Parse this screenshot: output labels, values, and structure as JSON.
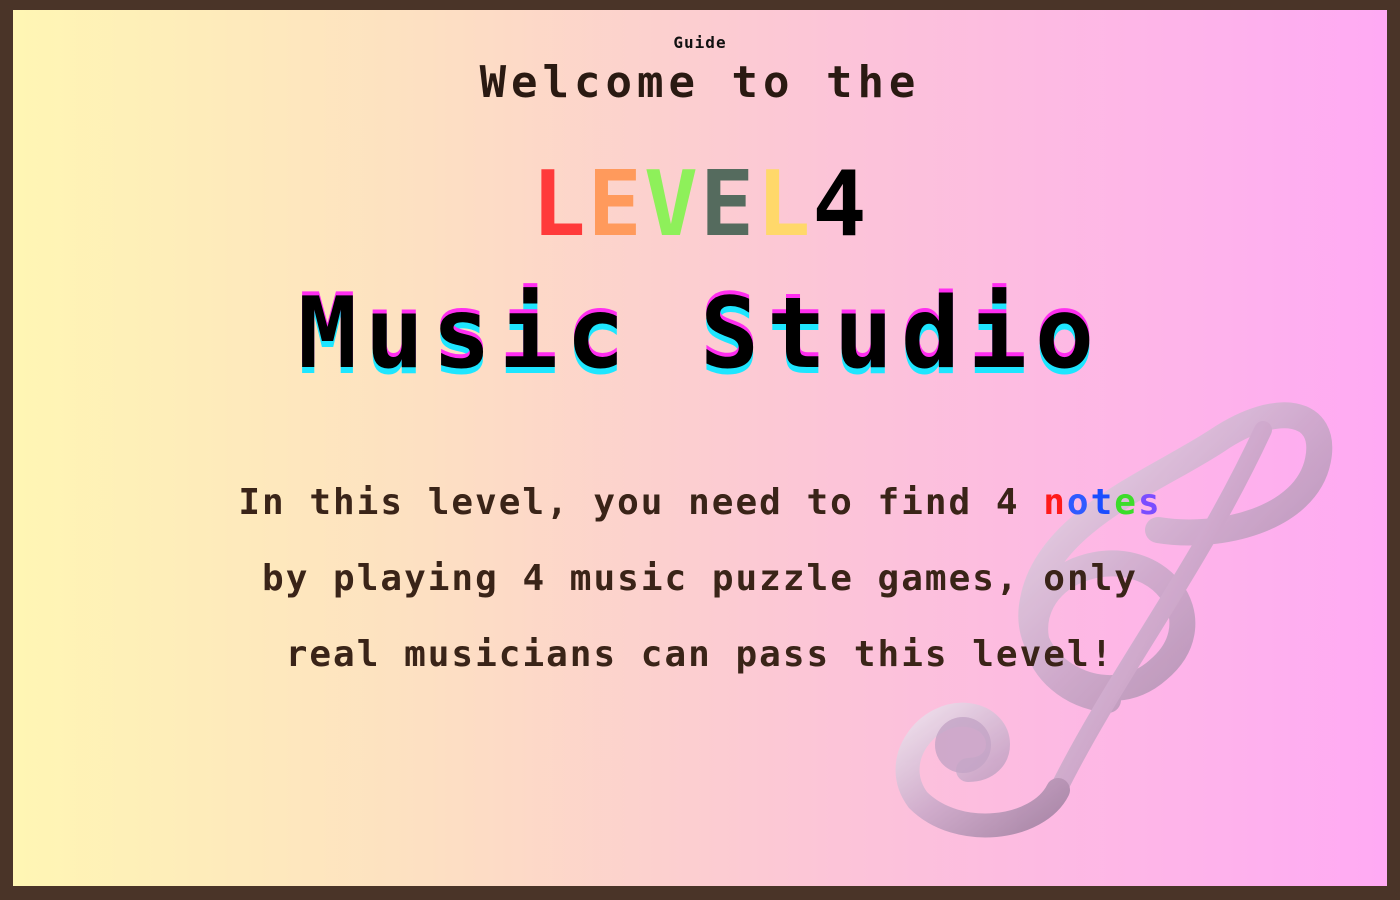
{
  "guide_label": "Guide",
  "welcome_text": "Welcome to the",
  "level": {
    "letters": [
      {
        "char": "L",
        "color": "#ff3a3a"
      },
      {
        "char": "E",
        "color": "#ff9a5c"
      },
      {
        "char": "V",
        "color": "#8ef05a"
      },
      {
        "char": "E",
        "color": "#556b5e"
      },
      {
        "char": "L",
        "color": "#ffd86a"
      }
    ],
    "number": "4",
    "number_color": "#000000"
  },
  "title": "Music Studio",
  "description": {
    "line1_prefix": "In this level, you need to find 4 ",
    "notes_letters": [
      {
        "char": "n",
        "color": "#ff1a1a"
      },
      {
        "char": "o",
        "color": "#2f5bff"
      },
      {
        "char": "t",
        "color": "#1a4dff"
      },
      {
        "char": "e",
        "color": "#3cdc2a"
      },
      {
        "char": "s",
        "color": "#7a4dff"
      }
    ],
    "line2": "by playing 4 music puzzle games, only",
    "line3": "real musicians can pass this level!"
  },
  "decoration": {
    "icon": "treble-clef-icon"
  },
  "colors": {
    "border": "#4a3428",
    "gradient_start": "#fff6b4",
    "gradient_end": "#ffaaf4",
    "title_shadow_top": "#ff2ef0",
    "title_shadow_bottom": "#1ee6ff"
  }
}
